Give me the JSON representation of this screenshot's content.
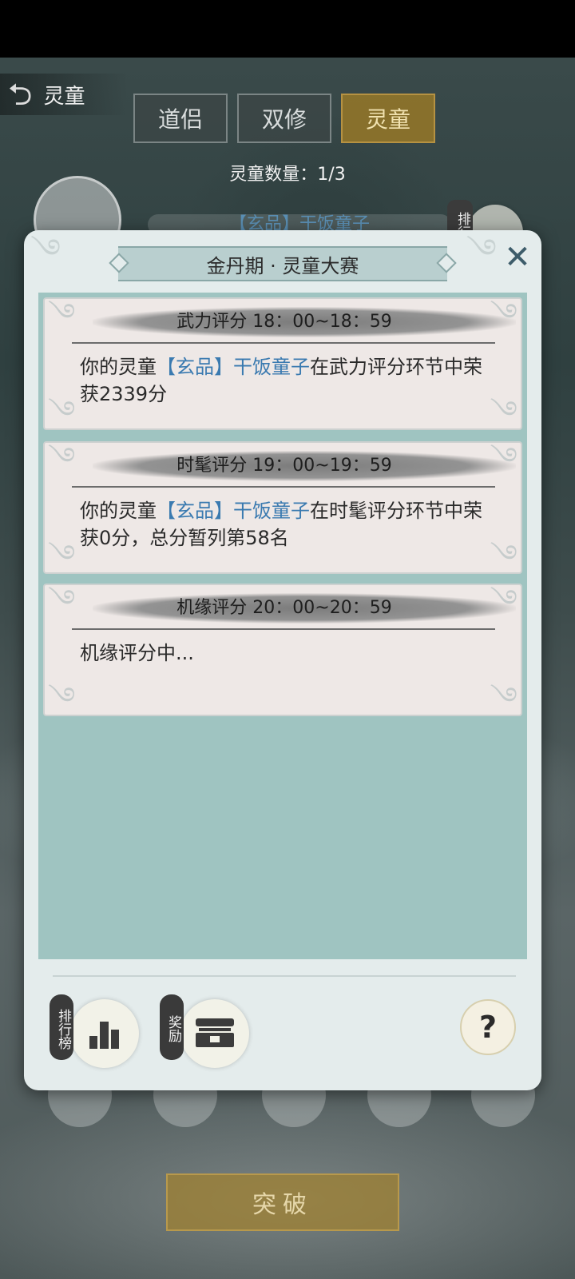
{
  "header": {
    "back_title": "灵童"
  },
  "tabs": [
    {
      "label": "道侣",
      "active": false
    },
    {
      "label": "双修",
      "active": false
    },
    {
      "label": "灵童",
      "active": true
    }
  ],
  "spirit_count_label": "灵童数量：1/3",
  "spirit_name_behind": "【玄品】干饭童子",
  "side_rank_label": "排行",
  "breakthrough_label": "突破",
  "modal": {
    "title": "金丹期 · 灵童大赛",
    "close_icon": "close-x-icon",
    "cards": [
      {
        "title": "武力评分 18：00~18：59",
        "body_prefix": "你的灵童",
        "highlight": "【玄品】干饭童子",
        "body_suffix": "在武力评分环节中荣获2339分"
      },
      {
        "title": "时髦评分 19：00~19：59",
        "body_prefix": "你的灵童",
        "highlight": "【玄品】干饭童子",
        "body_suffix": "在时髦评分环节中荣获0分，总分暂列第58名"
      },
      {
        "title": "机缘评分 20：00~20：59",
        "body_prefix": "机缘评分中...",
        "highlight": "",
        "body_suffix": ""
      }
    ],
    "rank_button_label": "排行榜",
    "reward_button_label": "奖励",
    "help_label": "?"
  },
  "colors": {
    "accent_gold": "#b69242",
    "highlight_blue": "#3a7ab0",
    "panel_teal": "#9fc4c1"
  }
}
